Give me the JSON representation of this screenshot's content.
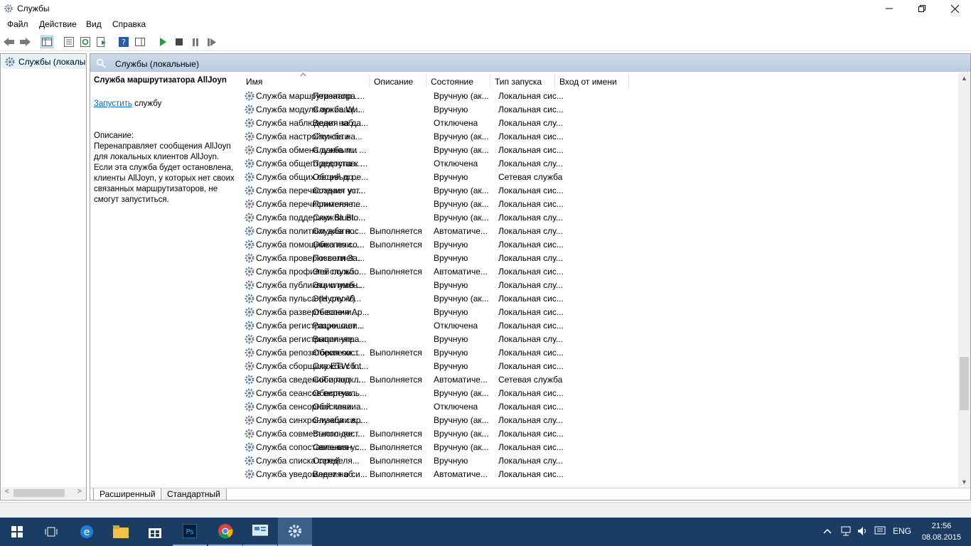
{
  "window": {
    "title": "Службы"
  },
  "menu": [
    "Файл",
    "Действие",
    "Вид",
    "Справка"
  ],
  "tree": {
    "item": "Службы (локалы"
  },
  "banner": {
    "title": "Службы (локальные)"
  },
  "details": {
    "name": "Служба маршрутизатора AllJoyn",
    "start_link": "Запустить",
    "start_suffix": " службу",
    "desc_label": "Описание:",
    "desc_text": "Перенаправляет сообщения AllJoyn для локальных клиентов AllJoyn. Если эта служба будет остановлена, клиенты AllJoyn, у которых нет своих связанных маршрутизаторов, не смогут запуститься."
  },
  "columns": [
    "Имя",
    "Описание",
    "Состояние",
    "Тип запуска",
    "Вход от имени"
  ],
  "rows": [
    [
      "Служба маршрутизатора ...",
      "Перенапр...",
      "",
      "Вручную (ак...",
      "Локальная сис..."
    ],
    [
      "Служба модуля архиваци...",
      "Служба W...",
      "",
      "Вручную",
      "Локальная сис..."
    ],
    [
      "Служба наблюдения за да...",
      "Ведет наб...",
      "",
      "Отключена",
      "Локальная слу..."
    ],
    [
      "Служба настройки сети",
      "Служба на...",
      "",
      "Вручную (ак...",
      "Локальная сис..."
    ],
    [
      "Служба обмена данными ...",
      "Служба п...",
      "",
      "Вручную (ак...",
      "Локальная сис..."
    ],
    [
      "Служба общего доступа к ...",
      "Предостав...",
      "",
      "Отключена",
      "Локальная слу..."
    ],
    [
      "Служба общих сетевых ре...",
      "Общий до...",
      "",
      "Вручную",
      "Сетевая служба"
    ],
    [
      "Служба перечисления уст...",
      "Создает уз...",
      "",
      "Вручную (ак...",
      "Локальная сис..."
    ],
    [
      "Служба перечислителя пе...",
      "Применяе...",
      "",
      "Вручную (ак...",
      "Локальная сис..."
    ],
    [
      "Служба поддержки Blueto...",
      "Служба Bl...",
      "",
      "Вручную (ак...",
      "Локальная слу..."
    ],
    [
      "Служба политики диагнос...",
      "Служба п...",
      "Выполняется",
      "Автоматиче...",
      "Локальная слу..."
    ],
    [
      "Служба помощника по со...",
      "Обеспечи...",
      "Выполняется",
      "Вручную",
      "Локальная сис..."
    ],
    [
      "Служба проверки сети За...",
      "Позволяет...",
      "",
      "Вручную",
      "Локальная слу..."
    ],
    [
      "Служба профилей пользо...",
      "Эта служб...",
      "Выполняется",
      "Автоматиче...",
      "Локальная сис..."
    ],
    [
      "Служба публикации имен...",
      "Эта служб...",
      "",
      "Вручную",
      "Локальная слу..."
    ],
    [
      "Служба пульса (Hyper-V)",
      "Эта служб...",
      "",
      "Вручную (ак...",
      "Локальная сис..."
    ],
    [
      "Служба развертывания Ap...",
      "Обеспечи...",
      "",
      "Вручную",
      "Локальная сис..."
    ],
    [
      "Служба регистрации оши...",
      "Разрешает...",
      "",
      "Отключена",
      "Локальная сис..."
    ],
    [
      "Служба регистрации упра...",
      "Выполняе...",
      "",
      "Вручную",
      "Локальная слу..."
    ],
    [
      "Служба репозитория сост...",
      "Обеспечи...",
      "Выполняется",
      "Вручную",
      "Локальная сис..."
    ],
    [
      "Служба сборщика ETW Int...",
      "Служба сб...",
      "",
      "Вручную",
      "Локальная сис..."
    ],
    [
      "Служба сведений о подкл...",
      "Собирает ...",
      "Выполняется",
      "Автоматиче...",
      "Сетевая служба"
    ],
    [
      "Служба сеансов виртуаль...",
      "Обеспечи...",
      "",
      "Вручную (ак...",
      "Локальная сис..."
    ],
    [
      "Служба сенсорной клавиа...",
      "Обеспечи...",
      "",
      "Отключена",
      "Локальная сис..."
    ],
    [
      "Служба синхронизации вр...",
      "Служба си...",
      "",
      "Вручную (ак...",
      "Локальная слу..."
    ],
    [
      "Служба совместного дост...",
      "Выполняе...",
      "Выполняется",
      "Вручную (ак...",
      "Локальная сис..."
    ],
    [
      "Служба сопоставления ус...",
      "Связыван...",
      "Выполняется",
      "Вручную (ак...",
      "Локальная сис..."
    ],
    [
      "Служба списка сетей",
      "Определя...",
      "Выполняется",
      "Вручную",
      "Локальная слу..."
    ],
    [
      "Служба уведомления о си...",
      "Ведет наб...",
      "Выполняется",
      "Автоматиче...",
      "Локальная сис..."
    ]
  ],
  "tabs": [
    "Расширенный",
    "Стандартный"
  ],
  "tray": {
    "lang": "ENG",
    "time": "21:56",
    "date": "08.08.2015"
  },
  "colors": {
    "taskbar": "#1c3d63",
    "banner": "#c3d3e4",
    "link": "#0066cc"
  }
}
